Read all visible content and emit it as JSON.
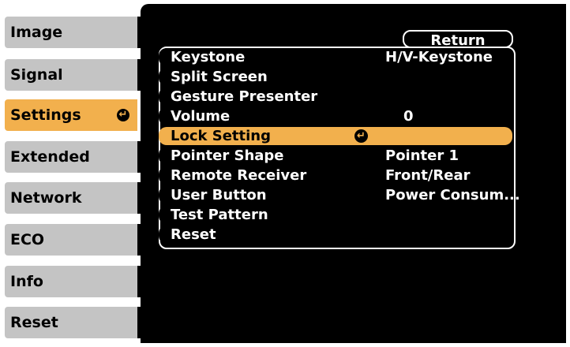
{
  "sidebar": {
    "items": [
      {
        "label": "Image"
      },
      {
        "label": "Signal"
      },
      {
        "label": "Settings"
      },
      {
        "label": "Extended"
      },
      {
        "label": "Network"
      },
      {
        "label": "ECO"
      },
      {
        "label": "Info"
      },
      {
        "label": "Reset"
      }
    ],
    "active_index": 2
  },
  "panel": {
    "return_label": "Return",
    "rows": [
      {
        "label": "Keystone",
        "value": "H/V-Keystone"
      },
      {
        "label": "Split Screen",
        "value": ""
      },
      {
        "label": "Gesture Presenter",
        "value": ""
      },
      {
        "label": "Volume",
        "value": "0"
      },
      {
        "label": "Lock Setting",
        "value": ""
      },
      {
        "label": "Pointer Shape",
        "value": "Pointer 1"
      },
      {
        "label": "Remote Receiver",
        "value": "Front/Rear"
      },
      {
        "label": "User Button",
        "value": "Power Consum..."
      },
      {
        "label": "Test Pattern",
        "value": ""
      },
      {
        "label": "Reset",
        "value": ""
      }
    ],
    "selected_index": 4
  },
  "icons": {
    "enter": "enter-icon"
  },
  "colors": {
    "highlight": "#f2b04d",
    "tab": "#c4c4c4",
    "panel": "#000000",
    "text": "#ffffff"
  }
}
